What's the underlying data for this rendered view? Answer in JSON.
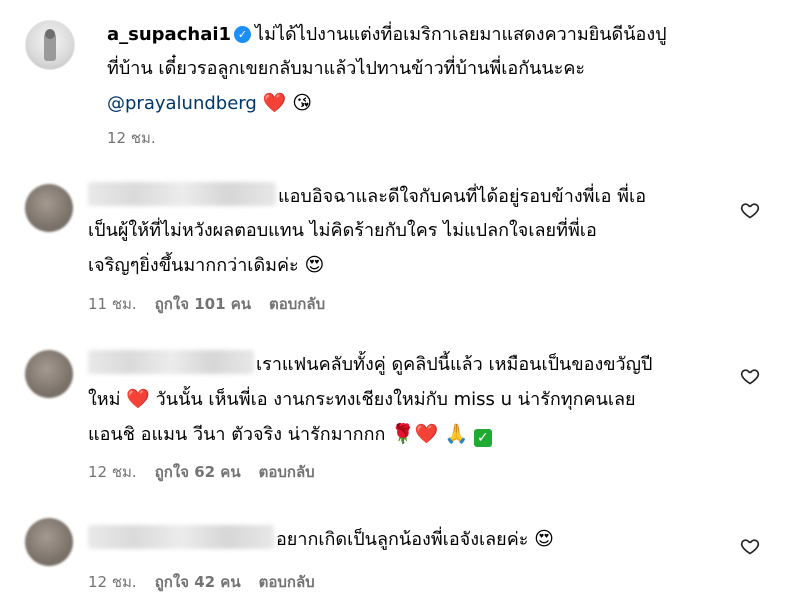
{
  "post": {
    "username": "a_supachai1",
    "line1": "ไม่ได้ไปงานแต่งที่อเมริกาเลยมาแสดงความยินดีน้องปู",
    "line2": "ที่บ้าน เดี๋ยวรอลูกเขยกลับมาแล้วไปทานข้าวที่บ้านพี่เอกันนะคะ",
    "mention": "@prayalundberg",
    "emoji": "❤️ 😘",
    "time": "12 ชม."
  },
  "comments": [
    {
      "line1": "แอบอิจฉาและดีใจกับคนที่ได้อยู่รอบข้างพี่เอ พี่เอ",
      "line2": "เป็นผู้ให้ที่ไม่หวังผลตอบแทน ไม่คิดร้ายกับใคร ไม่แปลกใจเลยที่พี่เอ",
      "line3": "เจริญๆยิ่งขึ้นมากกว่าเดิมค่ะ",
      "line3_emoji": "😍",
      "time": "11 ชม.",
      "likes": "ถูกใจ 101 คน",
      "reply": "ตอบกลับ"
    },
    {
      "line1": "เราแฟนคลับทั้งคู่ ดูคลิปนี้แล้ว เหมือนเป็นของขวัญปี",
      "line2_a": "ใหม่",
      "line2_emoji": "❤️",
      "line2_b": "วันนั้น เห็นพี่เอ งานกระทงเชียงใหม่กับ miss u น่ารักทุกคนเลย",
      "line3": "แอนชิ อแมน วีนา ตัวจริง น่ารักมากกก",
      "line3_emoji": "🌹❤️ 🙏",
      "line3_check": "✓",
      "time": "12 ชม.",
      "likes": "ถูกใจ 62 คน",
      "reply": "ตอบกลับ"
    },
    {
      "line1": "อยากเกิดเป็นลูกน้องพี่เอจังเลยค่ะ",
      "line1_emoji": "😍",
      "time": "12 ชม.",
      "likes": "ถูกใจ 42 คน",
      "reply": "ตอบกลับ"
    }
  ],
  "icons": {
    "verified": "verified-badge-icon",
    "like": "heart-outline-icon"
  },
  "colors": {
    "accent": "#1c8ff7",
    "mention": "#00376b",
    "muted": "#737373"
  }
}
